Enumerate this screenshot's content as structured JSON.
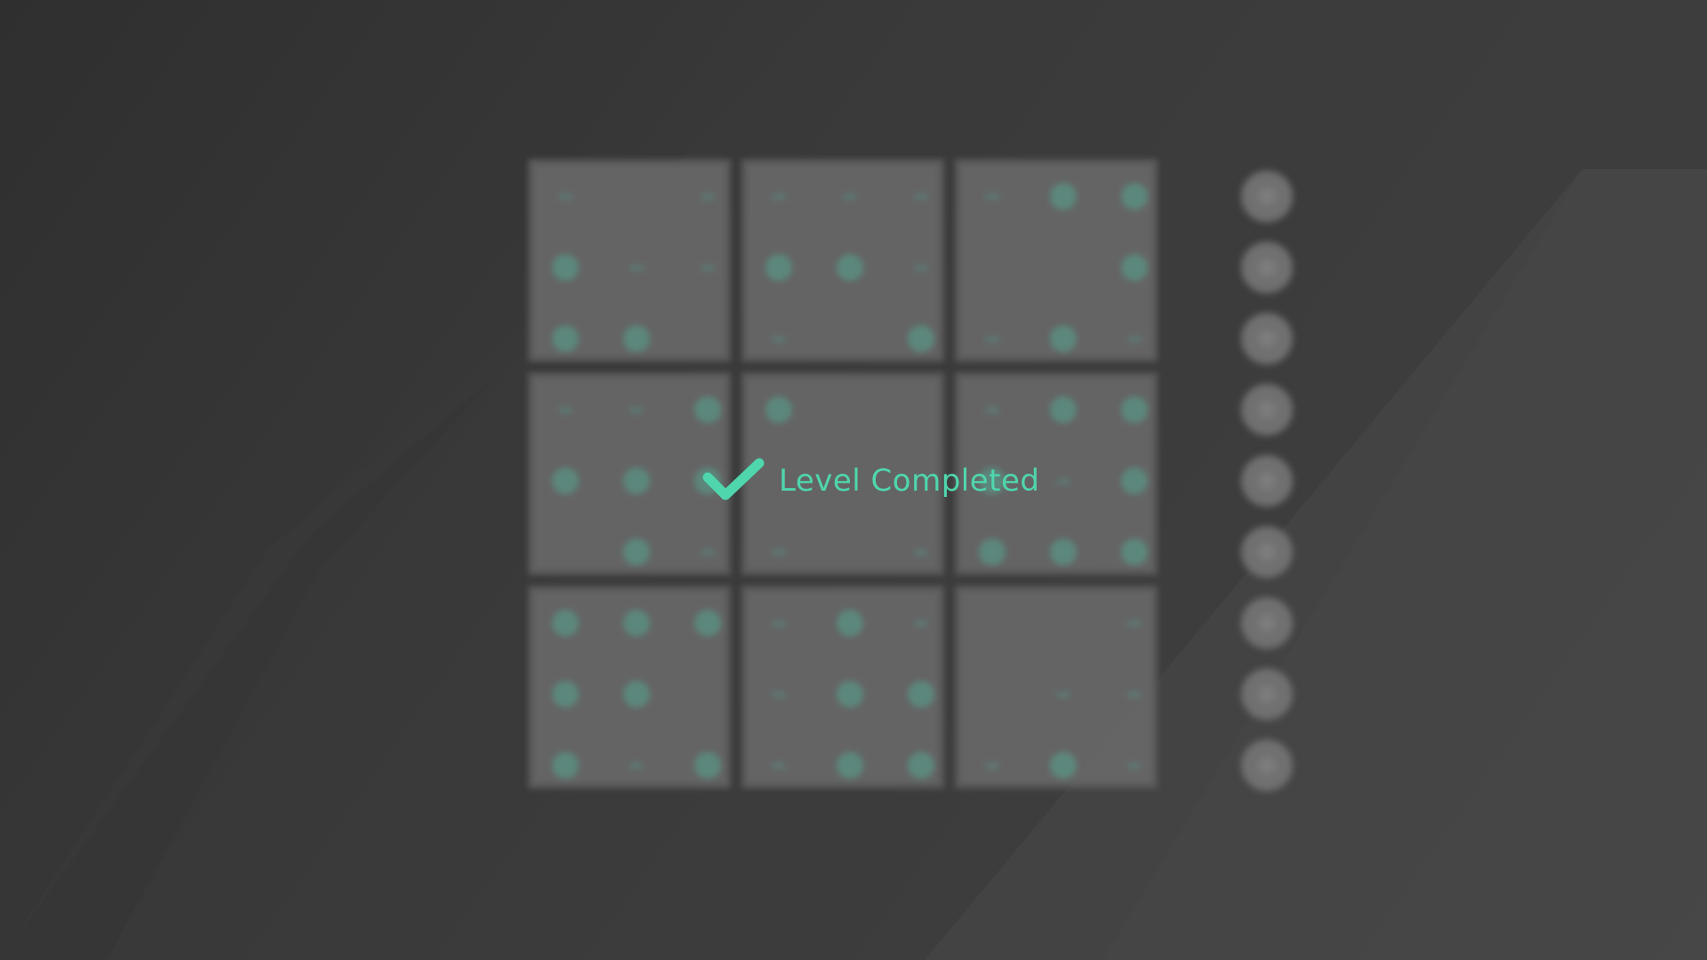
{
  "status": {
    "message": "Level Completed",
    "icon": "checkmark-icon",
    "accent_color": "#4fd6ad"
  },
  "board": {
    "box_rows": 3,
    "box_cols": 3,
    "cells_per_box_side": 3,
    "box_color": "#676767",
    "pip_color": "#5e8c80",
    "pips": [
      [
        "s",
        "",
        "s",
        "b",
        "s",
        "s",
        "b",
        "b",
        ""
      ],
      [
        "s",
        "s",
        "s",
        "b",
        "b",
        "s",
        "s",
        "",
        "b"
      ],
      [
        "s",
        "b",
        "b",
        "",
        "",
        "b",
        "s",
        "b",
        "s"
      ],
      [
        "s",
        "s",
        "b",
        "b",
        "b",
        "b",
        "",
        "b",
        "s"
      ],
      [
        "b",
        "",
        "",
        "",
        "",
        "",
        "s",
        "",
        "s"
      ],
      [
        "s",
        "b",
        "b",
        "b",
        "s",
        "b",
        "b",
        "b",
        "b"
      ],
      [
        "b",
        "b",
        "b",
        "b",
        "b",
        "",
        "b",
        "s",
        "b"
      ],
      [
        "s",
        "b",
        "s",
        "s",
        "b",
        "b",
        "s",
        "b",
        "b"
      ],
      [
        "",
        "",
        "s",
        "",
        "s",
        "s",
        "s",
        "b",
        "s"
      ]
    ]
  },
  "number_picker": {
    "count": 9,
    "button_color": "#707070"
  },
  "background": {
    "colors": [
      "#2f2f2f",
      "#373737",
      "#3e3e3e",
      "#464646"
    ]
  }
}
